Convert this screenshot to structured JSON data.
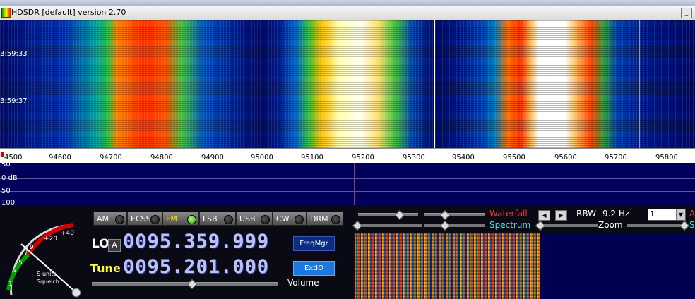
{
  "app": {
    "title": "HDSDR [default]  version 2.70",
    "minimize_label": "_"
  },
  "waterfall": {
    "timestamps": [
      "3:59:33",
      "3:59:37"
    ]
  },
  "frequency_axis": {
    "left_label": "4500",
    "ticks": [
      "94600",
      "94700",
      "94800",
      "94900",
      "95000",
      "95100",
      "95200",
      "95300",
      "95400",
      "95500",
      "95600",
      "95700",
      "95800"
    ]
  },
  "spectrum": {
    "labels": [
      "50",
      "0 dB",
      "50",
      "100"
    ]
  },
  "modes": [
    {
      "label": "AM",
      "active": false
    },
    {
      "label": "ECSS",
      "active": false
    },
    {
      "label": "FM",
      "active": true
    },
    {
      "label": "LSB",
      "active": false
    },
    {
      "label": "USB",
      "active": false
    },
    {
      "label": "CW",
      "active": false
    },
    {
      "label": "DRM",
      "active": false
    }
  ],
  "lo": {
    "label": "LO",
    "badge": "A",
    "frequency": "0095.359.999"
  },
  "tune": {
    "label": "Tune",
    "frequency": "0095.201.000"
  },
  "buttons": {
    "freqmgr": "FreqMgr",
    "extio": "ExtIO"
  },
  "volume": {
    "label": "Volume",
    "level": 0.54
  },
  "meter": {
    "scale_labels": [
      "+40",
      "+20",
      "9",
      "7",
      "5",
      "3",
      "1"
    ],
    "caption_line1": "S-units",
    "caption_line2": "Squelch"
  },
  "right_panel": {
    "waterfall_label": "Waterfall",
    "spectrum_label": "Spectrum",
    "rbw_label": "RBW",
    "rbw_value": "9.2 Hz",
    "zoom_label": "Zoom",
    "combo_value": "1",
    "edge_letter_a": "A",
    "edge_letter_s": "S"
  },
  "colors": {
    "lo_freq": "#b9c2ff",
    "tune_label": "#ffff40",
    "waterfall_label": "#ff3030",
    "spectrum_label": "#40e0e0",
    "marker_red": "#b00000"
  }
}
